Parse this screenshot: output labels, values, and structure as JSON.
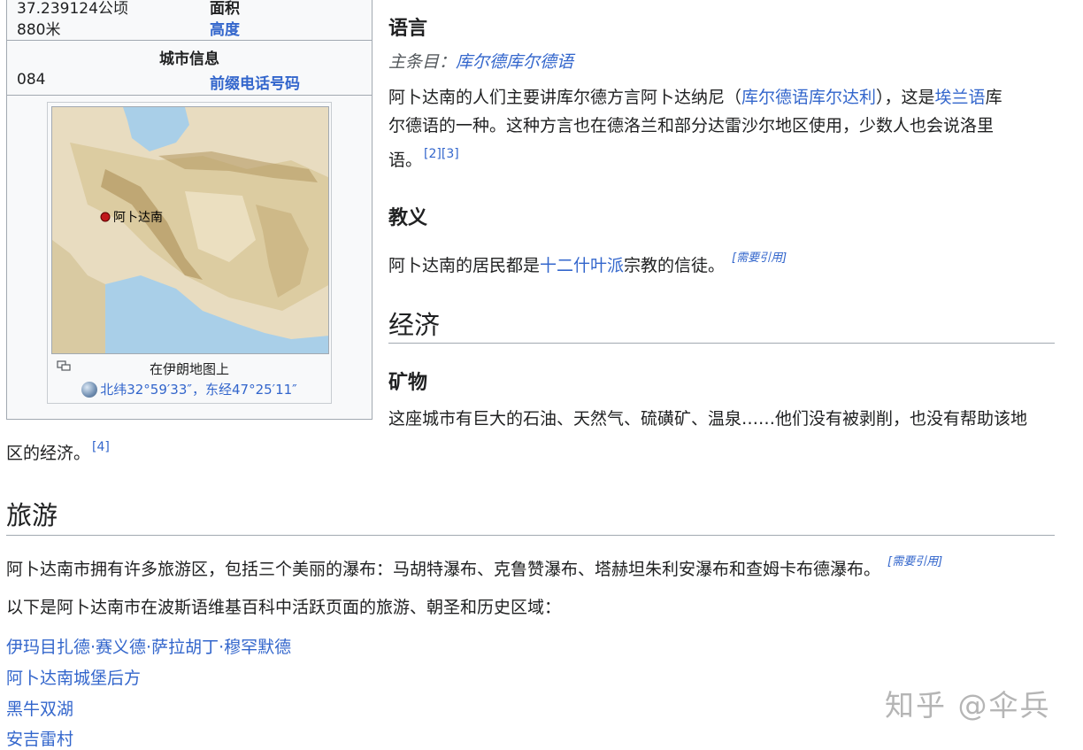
{
  "infobox": {
    "area_value": "37.239124公顷",
    "area_label": "面积",
    "height_value": "880米",
    "height_label": "高度",
    "city_info_heading": "城市信息",
    "phone_value": "084",
    "phone_label": "前缀电话号码",
    "map": {
      "city_label": "阿卜达南",
      "caption": "在伊朗地图上",
      "coords": "北纬32°59′33″，东经47°25′11″"
    }
  },
  "language": {
    "heading": "语言",
    "hatnote_prefix": "主条目：",
    "hatnote_link": "库尔德库尔德语",
    "p1_a": "阿卜达南的人们主要讲库尔德方言阿卜达纳尼（",
    "p1_link1": "库尔德语库尔达利",
    "p1_b": "），这是",
    "p1_link2": "埃兰语",
    "p1_c": "库",
    "p2": "尔德语的一种。这种方言也在德洛兰和部分达雷沙尔地区使用，少数人也会说洛里",
    "p3": "语。",
    "ref1": "[2]",
    "ref2": "[3]"
  },
  "religion": {
    "heading": "教义",
    "text_a": "阿卜达南的居民都是",
    "link": "十二什叶派",
    "text_b": "宗教的信徒。",
    "cn": "[需要引用]"
  },
  "economy": {
    "heading": "经济",
    "sub_heading": "矿物",
    "line1": "这座城市有巨大的石油、天然气、硫磺矿、温泉……他们没有被剥削，也没有帮助该地",
    "line2": "区的经济。",
    "ref": "[4]"
  },
  "tourism": {
    "heading": "旅游",
    "p1": "阿卜达南市拥有许多旅游区，包括三个美丽的瀑布：马胡特瀑布、克鲁赞瀑布、塔赫坦朱利安瀑布和查姆卡布德瀑布。",
    "cn": "[需要引用]",
    "p2": "以下是阿卜达南市在波斯语维基百科中活跃页面的旅游、朝圣和历史区域：",
    "links": [
      "伊玛目扎德·赛义德·萨拉胡丁·穆罕默德",
      "阿卜达南城堡后方",
      "黑牛双湖",
      "安吉雷村"
    ]
  },
  "watermark": "知乎 @伞兵",
  "colors": {
    "link": "#3366cc",
    "text": "#202122",
    "border": "#a2a9b1"
  }
}
